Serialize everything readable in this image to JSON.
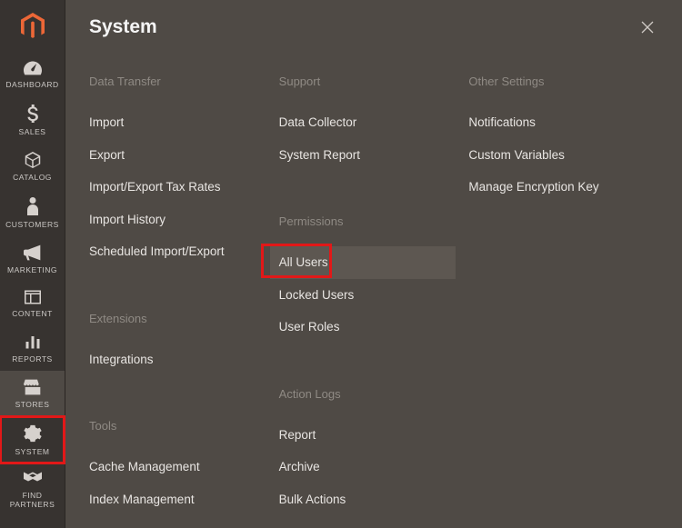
{
  "sidebar": {
    "items": [
      {
        "label": "DASHBOARD"
      },
      {
        "label": "SALES"
      },
      {
        "label": "CATALOG"
      },
      {
        "label": "CUSTOMERS"
      },
      {
        "label": "MARKETING"
      },
      {
        "label": "CONTENT"
      },
      {
        "label": "REPORTS"
      },
      {
        "label": "STORES"
      },
      {
        "label": "SYSTEM"
      },
      {
        "label": "FIND PARTNERS"
      }
    ]
  },
  "panel": {
    "title": "System",
    "col1": {
      "section1_label": "Data Transfer",
      "links1": [
        "Import",
        "Export",
        "Import/Export Tax Rates",
        "Import History",
        "Scheduled Import/Export"
      ],
      "section2_label": "Extensions",
      "links2": [
        "Integrations"
      ],
      "section3_label": "Tools",
      "links3": [
        "Cache Management",
        "Index Management"
      ]
    },
    "col2": {
      "section1_label": "Support",
      "links1": [
        "Data Collector",
        "System Report"
      ],
      "section2_label": "Permissions",
      "links2": [
        "All Users",
        "Locked Users",
        "User Roles"
      ],
      "section3_label": "Action Logs",
      "links3": [
        "Report",
        "Archive",
        "Bulk Actions"
      ]
    },
    "col3": {
      "section1_label": "Other Settings",
      "links1": [
        "Notifications",
        "Custom Variables",
        "Manage Encryption Key"
      ]
    }
  }
}
